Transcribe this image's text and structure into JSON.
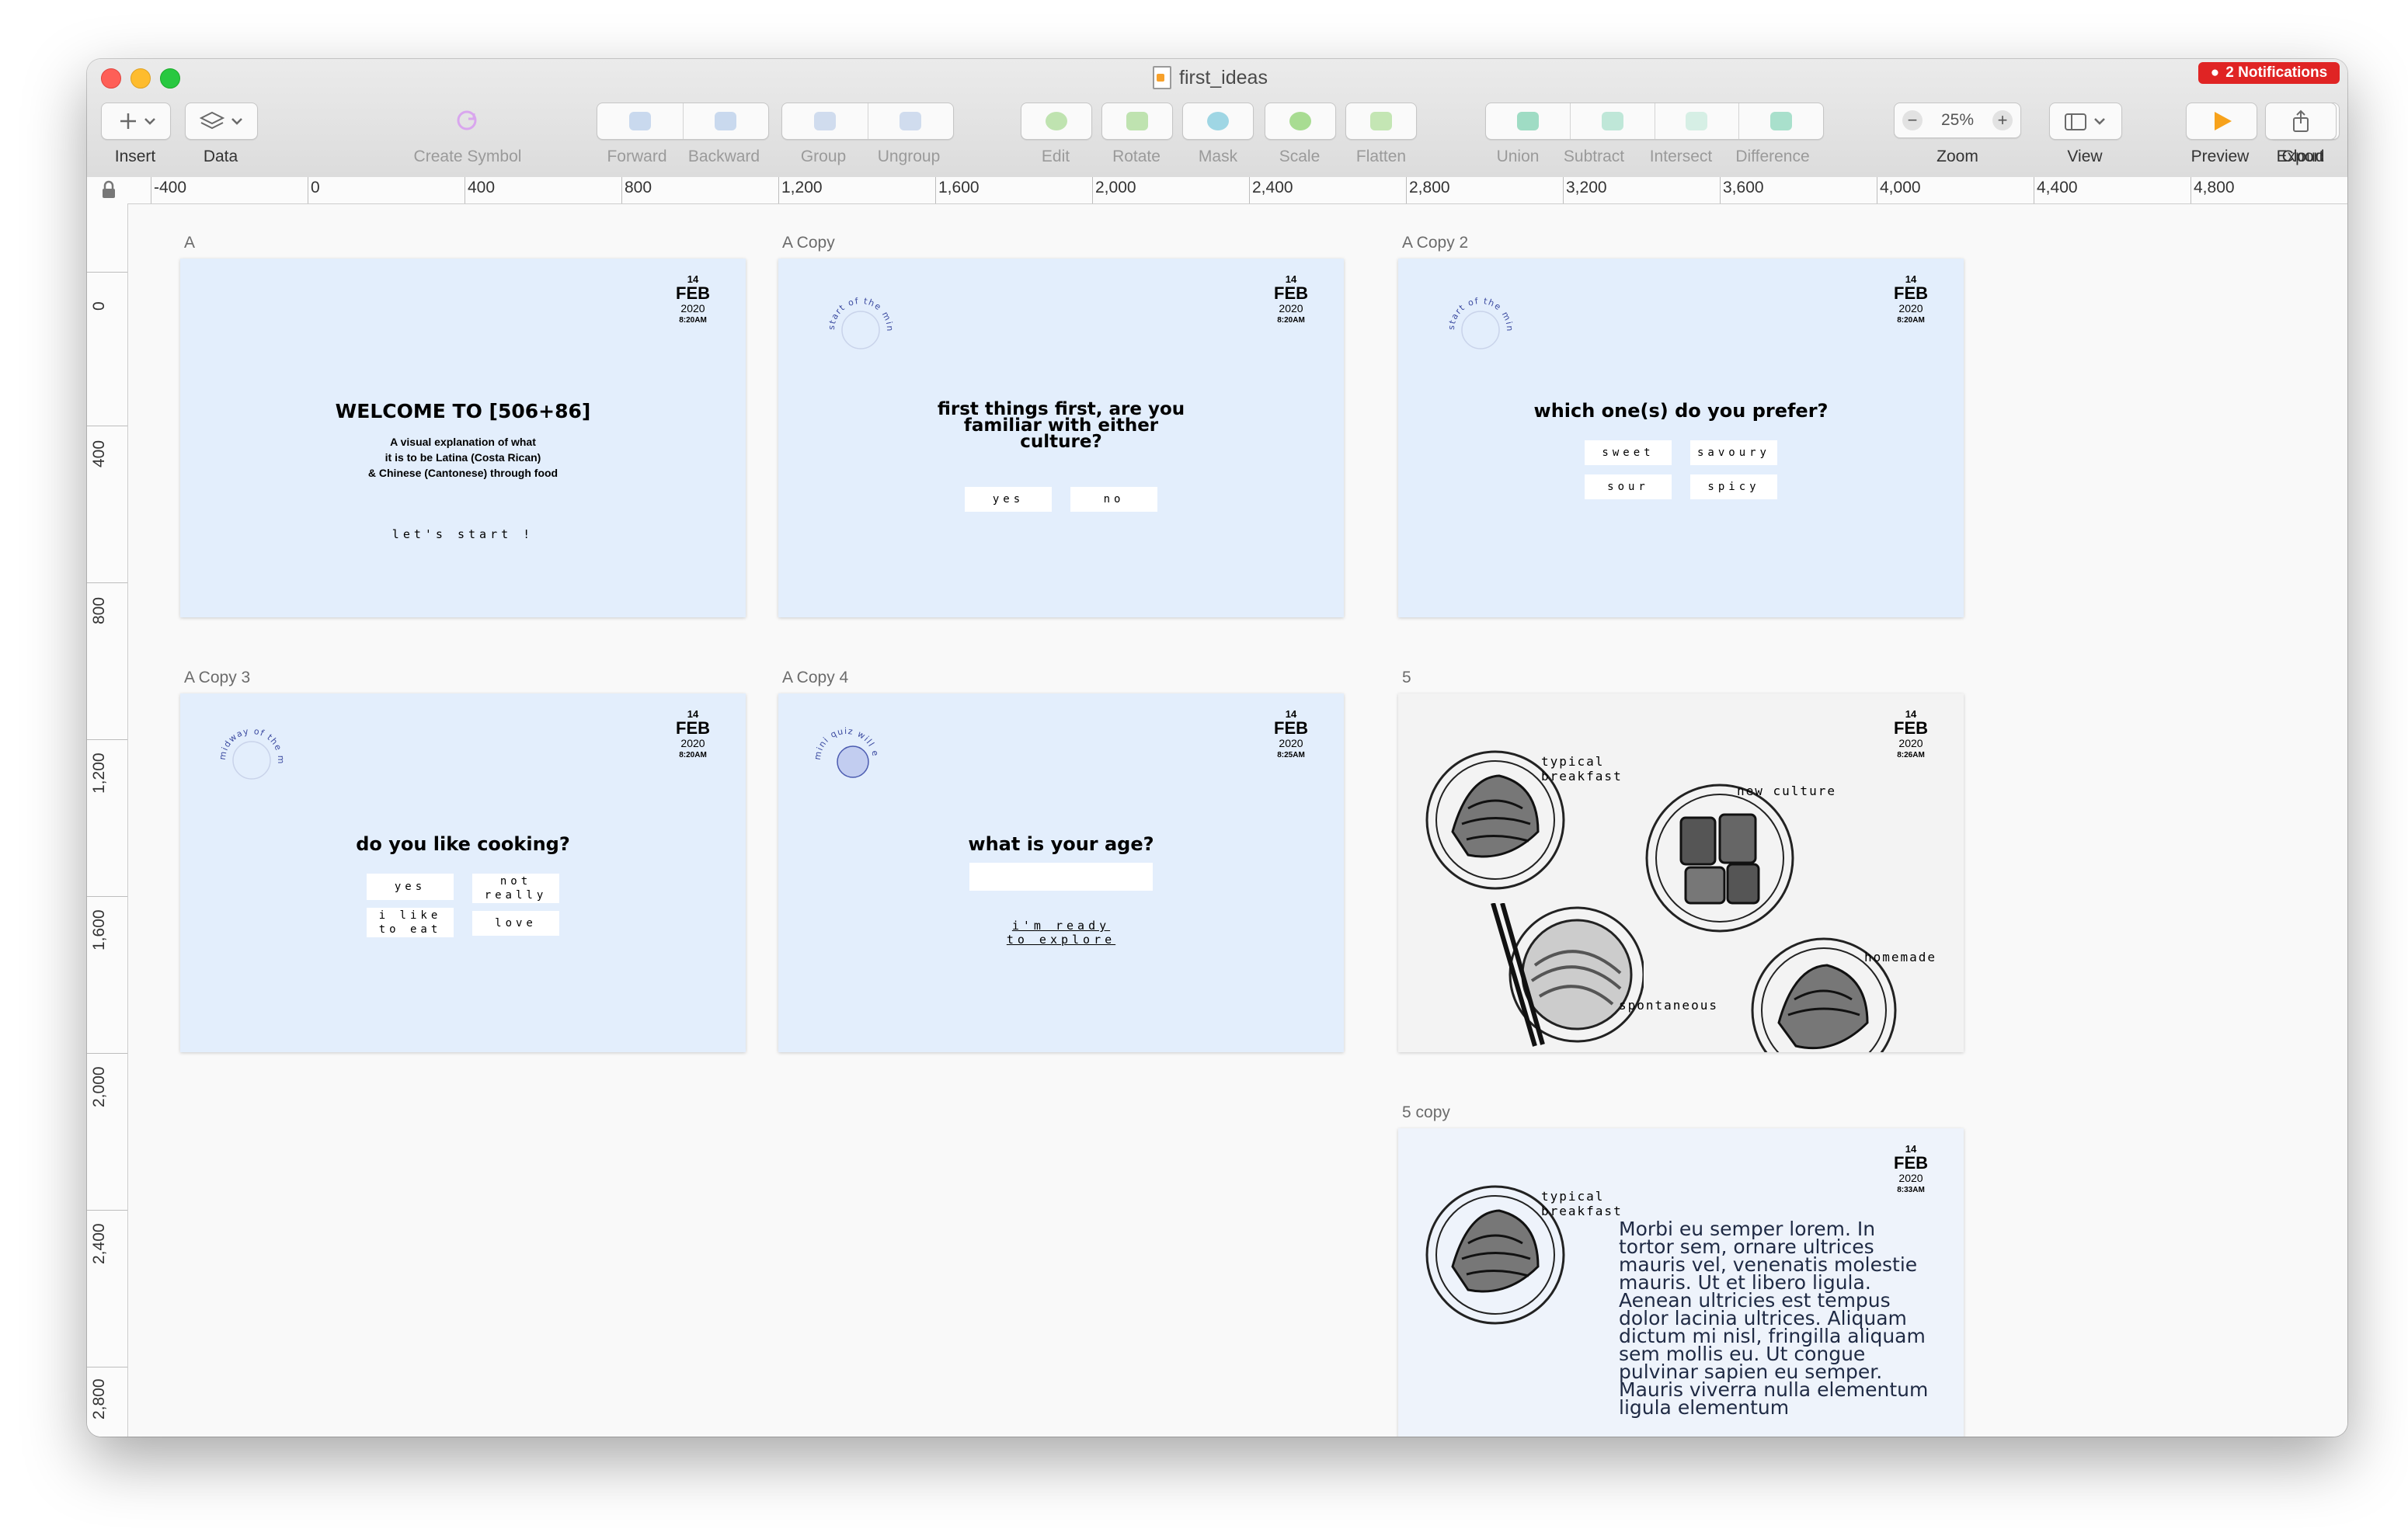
{
  "window": {
    "title": "first_ideas",
    "notifications": "2 Notifications"
  },
  "toolbar": {
    "insert": "Insert",
    "data": "Data",
    "create_symbol": "Create Symbol",
    "forward": "Forward",
    "backward": "Backward",
    "group": "Group",
    "ungroup": "Ungroup",
    "edit": "Edit",
    "rotate": "Rotate",
    "mask": "Mask",
    "scale": "Scale",
    "flatten": "Flatten",
    "union": "Union",
    "subtract": "Subtract",
    "intersect": "Intersect",
    "difference": "Difference",
    "zoom_label": "Zoom",
    "zoom_value": "25%",
    "view": "View",
    "preview": "Preview",
    "cloud": "Cloud",
    "export": "Export"
  },
  "rulers": {
    "horizontal": [
      "-400",
      "0",
      "400",
      "800",
      "1,200",
      "1,600",
      "2,000",
      "2,400",
      "2,800",
      "3,200",
      "3,600",
      "4,000",
      "4,400",
      "4,800"
    ],
    "vertical": [
      "0",
      "400",
      "800",
      "1,200",
      "1,600",
      "2,000",
      "2,400",
      "2,800"
    ]
  },
  "artboards": {
    "a": {
      "label": "A",
      "date": {
        "day": "14",
        "month": "FEB",
        "year": "2020",
        "time": "8:20AM"
      },
      "title": "WELCOME TO [506+86]",
      "subtitle": "A visual explanation of what\nit is to be Latina (Costa Rican)\n& Chinese (Cantonese) through food",
      "cta": "let's start !"
    },
    "a_copy": {
      "label": "A Copy",
      "date": {
        "day": "14",
        "month": "FEB",
        "year": "2020",
        "time": "8:20AM"
      },
      "badge": "start of the mini quiz",
      "title": "first things first, are you familiar with either culture?",
      "options": [
        "yes",
        "no"
      ]
    },
    "a_copy2": {
      "label": "A Copy 2",
      "date": {
        "day": "14",
        "month": "FEB",
        "year": "2020",
        "time": "8:20AM"
      },
      "badge": "start of the mini quiz",
      "title": "which one(s) do you prefer?",
      "options": [
        "sweet",
        "savoury",
        "sour",
        "spicy"
      ]
    },
    "a_copy3": {
      "label": "A Copy 3",
      "date": {
        "day": "14",
        "month": "FEB",
        "year": "2020",
        "time": "8:20AM"
      },
      "badge": "midway of the mini quiz",
      "title": "do you like cooking?",
      "options": [
        "yes",
        "not\nreally",
        "i like\nto eat",
        "love"
      ]
    },
    "a_copy4": {
      "label": "A Copy 4",
      "date": {
        "day": "14",
        "month": "FEB",
        "year": "2020",
        "time": "8:25AM"
      },
      "badge": "mini quiz will end",
      "title": "what is your age?",
      "cta": "i'm ready\nto explore"
    },
    "five": {
      "label": "5",
      "date": {
        "day": "14",
        "month": "FEB",
        "year": "2020",
        "time": "8:26AM"
      },
      "foods": [
        "typical\nbreakfast",
        "new culture",
        "spontaneous",
        "homemade"
      ]
    },
    "five_copy": {
      "label": "5 copy",
      "date": {
        "day": "14",
        "month": "FEB",
        "year": "2020",
        "time": "8:33AM"
      },
      "food": "typical\nbreakfast",
      "body": "Morbi eu semper lorem. In tortor sem, ornare ultrices mauris vel, venenatis molestie mauris. Ut et libero ligula. Aenean ultricies est tempus dolor lacinia ultrices. Aliquam dictum mi nisl, fringilla aliquam sem mollis eu. Ut congue pulvinar sapien eu semper. Mauris viverra nulla elementum ligula elementum"
    }
  }
}
